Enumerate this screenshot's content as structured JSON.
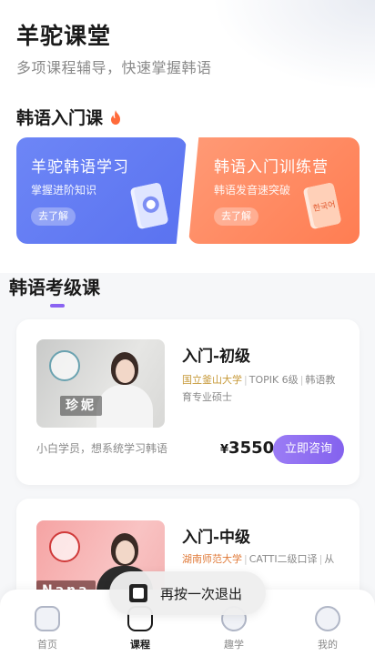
{
  "header": {
    "title": "羊驼课堂",
    "subtitle": "多项课程辅导，快速掌握韩语"
  },
  "intro_section": {
    "title": "韩语入门课",
    "cards": [
      {
        "title": "羊驼韩语学习",
        "subtitle": "掌握进阶知识",
        "button": "去了解"
      },
      {
        "title": "韩语入门训练营",
        "subtitle": "韩语发音速突破",
        "button": "去了解",
        "book_text": "한국어"
      }
    ]
  },
  "exam_section": {
    "title": "韩语考级课",
    "courses": [
      {
        "teacher": "珍妮",
        "title": "入门-初级",
        "school": "国立釜山大学",
        "tags": [
          "TOPIK 6级",
          "韩语教育专业硕士"
        ],
        "note": "小白学员，想系统学习韩语",
        "price_symbol": "¥",
        "price": "3550",
        "button": "立即咨询"
      },
      {
        "teacher": "Nana",
        "title": "入门-中级",
        "school": "湖南师范大学",
        "tags": [
          "CATTI二级口译",
          "从"
        ]
      }
    ]
  },
  "toast": {
    "text": "再按一次退出"
  },
  "tabbar": {
    "items": [
      {
        "label": "首页"
      },
      {
        "label": "课程"
      },
      {
        "label": "趣学"
      },
      {
        "label": "我的"
      }
    ],
    "active": "课程"
  },
  "colors": {
    "accent": "#8462ee",
    "blue_card": "#5a72f0",
    "orange_card": "#ff7d52"
  }
}
